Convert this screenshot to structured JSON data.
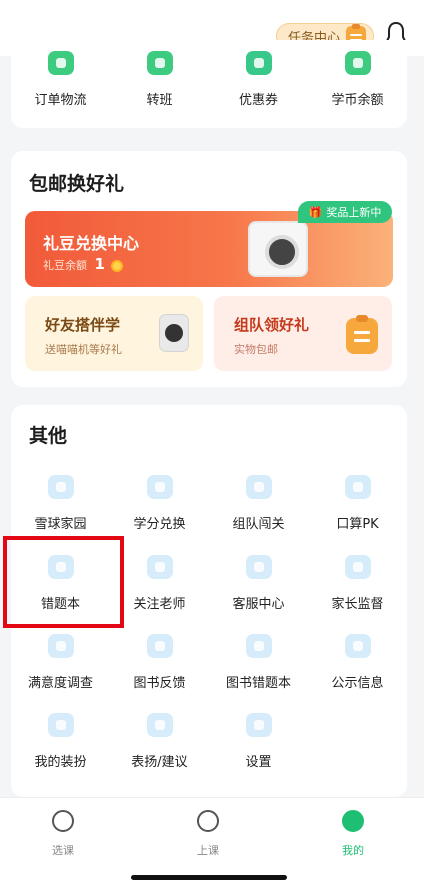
{
  "header": {
    "task_center": "任务中心"
  },
  "top_grid": [
    {
      "label": "订单物流",
      "icon": "order-icon"
    },
    {
      "label": "转班",
      "icon": "switch-class-icon"
    },
    {
      "label": "优惠券",
      "icon": "coupon-icon"
    },
    {
      "label": "学币余额",
      "icon": "coin-balance-icon"
    }
  ],
  "gifts": {
    "title": "包邮换好礼",
    "banner_title": "礼豆兑换中心",
    "balance_label": "礼豆余额",
    "balance_value": "1",
    "new_badge": "奖品上新中",
    "friend_title": "好友搭伴学",
    "friend_sub": "送喵喵机等好礼",
    "team_title": "组队领好礼",
    "team_sub": "实物包邮"
  },
  "other": {
    "title": "其他",
    "items": [
      {
        "label": "雪球家园",
        "icon": "snowball-home-icon"
      },
      {
        "label": "学分兑换",
        "icon": "credit-exchange-icon"
      },
      {
        "label": "组队闯关",
        "icon": "team-challenge-icon"
      },
      {
        "label": "口算PK",
        "icon": "mental-math-pk-icon"
      },
      {
        "label": "错题本",
        "icon": "mistake-book-icon"
      },
      {
        "label": "关注老师",
        "icon": "follow-teacher-icon"
      },
      {
        "label": "客服中心",
        "icon": "customer-service-icon"
      },
      {
        "label": "家长监督",
        "icon": "parent-supervision-icon"
      },
      {
        "label": "满意度调查",
        "icon": "survey-icon"
      },
      {
        "label": "图书反馈",
        "icon": "book-feedback-icon"
      },
      {
        "label": "图书错题本",
        "icon": "book-mistake-icon"
      },
      {
        "label": "公示信息",
        "icon": "public-info-icon"
      },
      {
        "label": "我的装扮",
        "icon": "outfit-icon"
      },
      {
        "label": "表扬/建议",
        "icon": "praise-suggest-icon"
      },
      {
        "label": "设置",
        "icon": "settings-icon"
      }
    ]
  },
  "tabs": [
    {
      "label": "选课",
      "icon": "select-course-icon"
    },
    {
      "label": "上课",
      "icon": "attend-class-icon"
    },
    {
      "label": "我的",
      "icon": "profile-icon"
    }
  ],
  "colors": {
    "accent": "#1fbf73",
    "highlight": "#e30613",
    "orange": "#f15a3a"
  }
}
